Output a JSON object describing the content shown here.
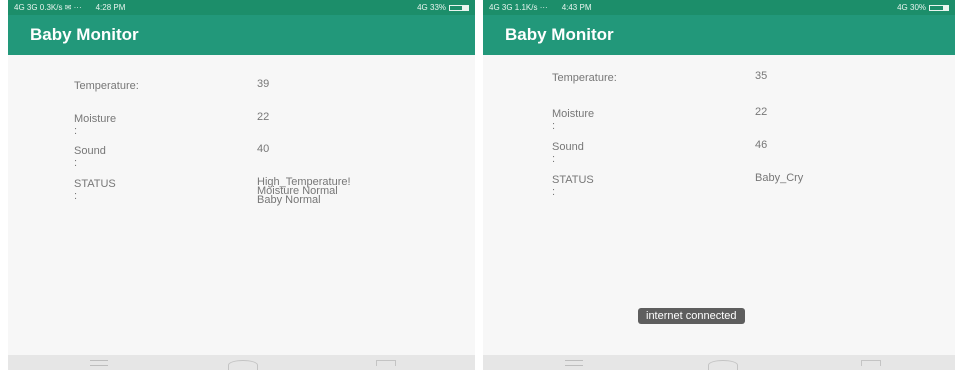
{
  "left": {
    "status": {
      "left": "4G 3G 0.3K/s ✉ ···",
      "time": "4:28 PM",
      "right": "4G 33%",
      "battery_level": 0.33
    },
    "app_title": "Baby Monitor",
    "rows": [
      {
        "label": "Temperature:",
        "value": "39"
      },
      {
        "label": "Moisture :",
        "value": "22"
      },
      {
        "label": "Sound :",
        "value": "40"
      }
    ],
    "status_row": {
      "label": "STATUS :",
      "lines": [
        "High_Temperature!",
        "Moisture Normal",
        "Baby Normal"
      ]
    }
  },
  "right": {
    "status": {
      "left": "4G 3G 1.1K/s ···",
      "time": "4:43 PM",
      "right": "4G 30%",
      "battery_level": 0.3
    },
    "app_title": "Baby Monitor",
    "rows": [
      {
        "label": "Temperature:",
        "value": "35"
      },
      {
        "label": "Moisture :",
        "value": "22"
      },
      {
        "label": "Sound :",
        "value": "46"
      }
    ],
    "status_row": {
      "label": "STATUS :",
      "value": "Baby_Cry"
    },
    "toast": "internet connected"
  }
}
